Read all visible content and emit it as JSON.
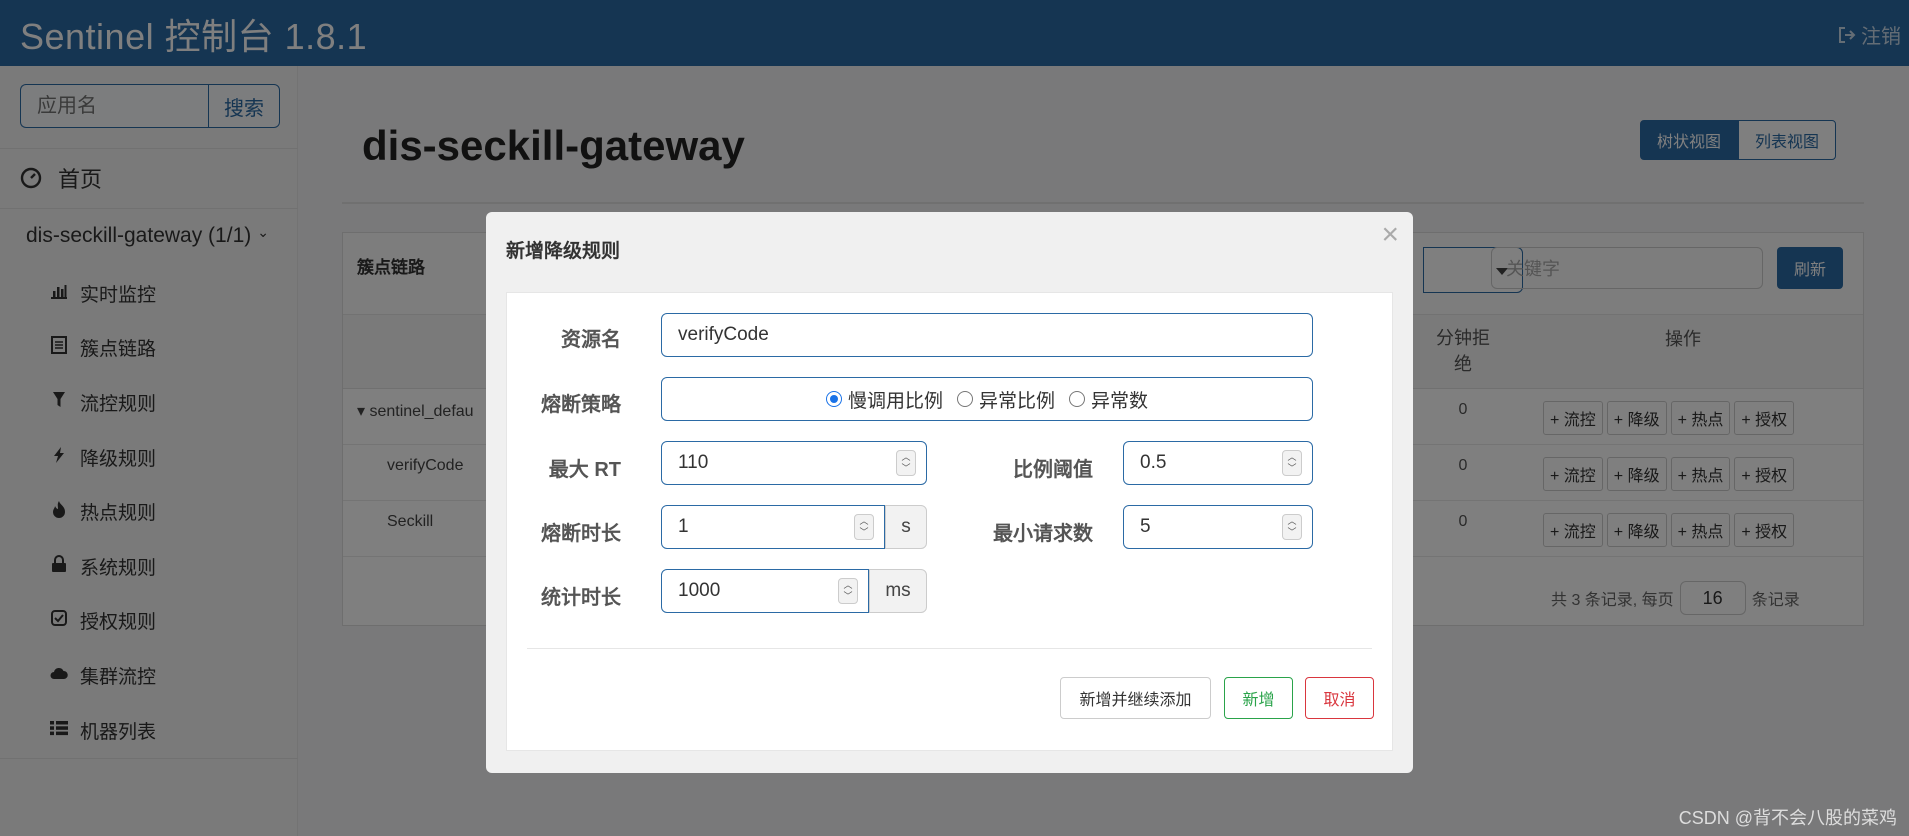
{
  "header": {
    "brand": "Sentinel 控制台 1.8.1",
    "logout_label": "注销"
  },
  "sidebar": {
    "search_placeholder": "应用名",
    "search_button": "搜索",
    "home_label": "首页",
    "app_label": "dis-seckill-gateway  (1/1)",
    "menu": [
      {
        "label": "实时监控",
        "icon": "bar-chart-icon"
      },
      {
        "label": "簇点链路",
        "icon": "list-icon"
      },
      {
        "label": "流控规则",
        "icon": "filter-icon"
      },
      {
        "label": "降级规则",
        "icon": "flash-icon"
      },
      {
        "label": "热点规则",
        "icon": "fire-icon"
      },
      {
        "label": "系统规则",
        "icon": "lock-icon"
      },
      {
        "label": "授权规则",
        "icon": "check-square-icon"
      },
      {
        "label": "集群流控",
        "icon": "cloud-icon"
      },
      {
        "label": "机器列表",
        "icon": "th-list-icon"
      }
    ]
  },
  "main": {
    "page_title": "dis-seckill-gateway",
    "view_tree": "树状视图",
    "view_list": "列表视图",
    "panel_title": "簇点链路",
    "keyword_placeholder": "关键字",
    "refresh": "刷新",
    "col_reject": "分钟拒绝",
    "col_ops": "操作",
    "rows": [
      {
        "resource": "sentinel_defau",
        "value": "0"
      },
      {
        "resource": "verifyCode",
        "value": "0"
      },
      {
        "resource": "Seckill",
        "value": "0"
      }
    ],
    "op_buttons": [
      "+ 流控",
      "+ 降级",
      "+ 热点",
      "+ 授权"
    ],
    "pager": {
      "prefix": "共 3 条记录, 每页",
      "page_size": "16",
      "suffix": "条记录"
    }
  },
  "modal": {
    "title": "新增降级规则",
    "close": "×",
    "resource_label": "资源名",
    "resource_value": "verifyCode",
    "strategy_label": "熔断策略",
    "strategy_options": [
      "慢调用比例",
      "异常比例",
      "异常数"
    ],
    "strategy_selected": "慢调用比例",
    "max_rt_label": "最大 RT",
    "max_rt_value": "110",
    "ratio_label": "比例阈值",
    "ratio_value": "0.5",
    "duration_label": "熔断时长",
    "duration_value": "1",
    "duration_unit": "s",
    "min_req_label": "最小请求数",
    "min_req_value": "5",
    "stat_label": "统计时长",
    "stat_value": "1000",
    "stat_unit": "ms",
    "btn_continue": "新增并继续添加",
    "btn_add": "新增",
    "btn_cancel": "取消"
  },
  "watermark": "CSDN @背不会八股的菜鸡"
}
